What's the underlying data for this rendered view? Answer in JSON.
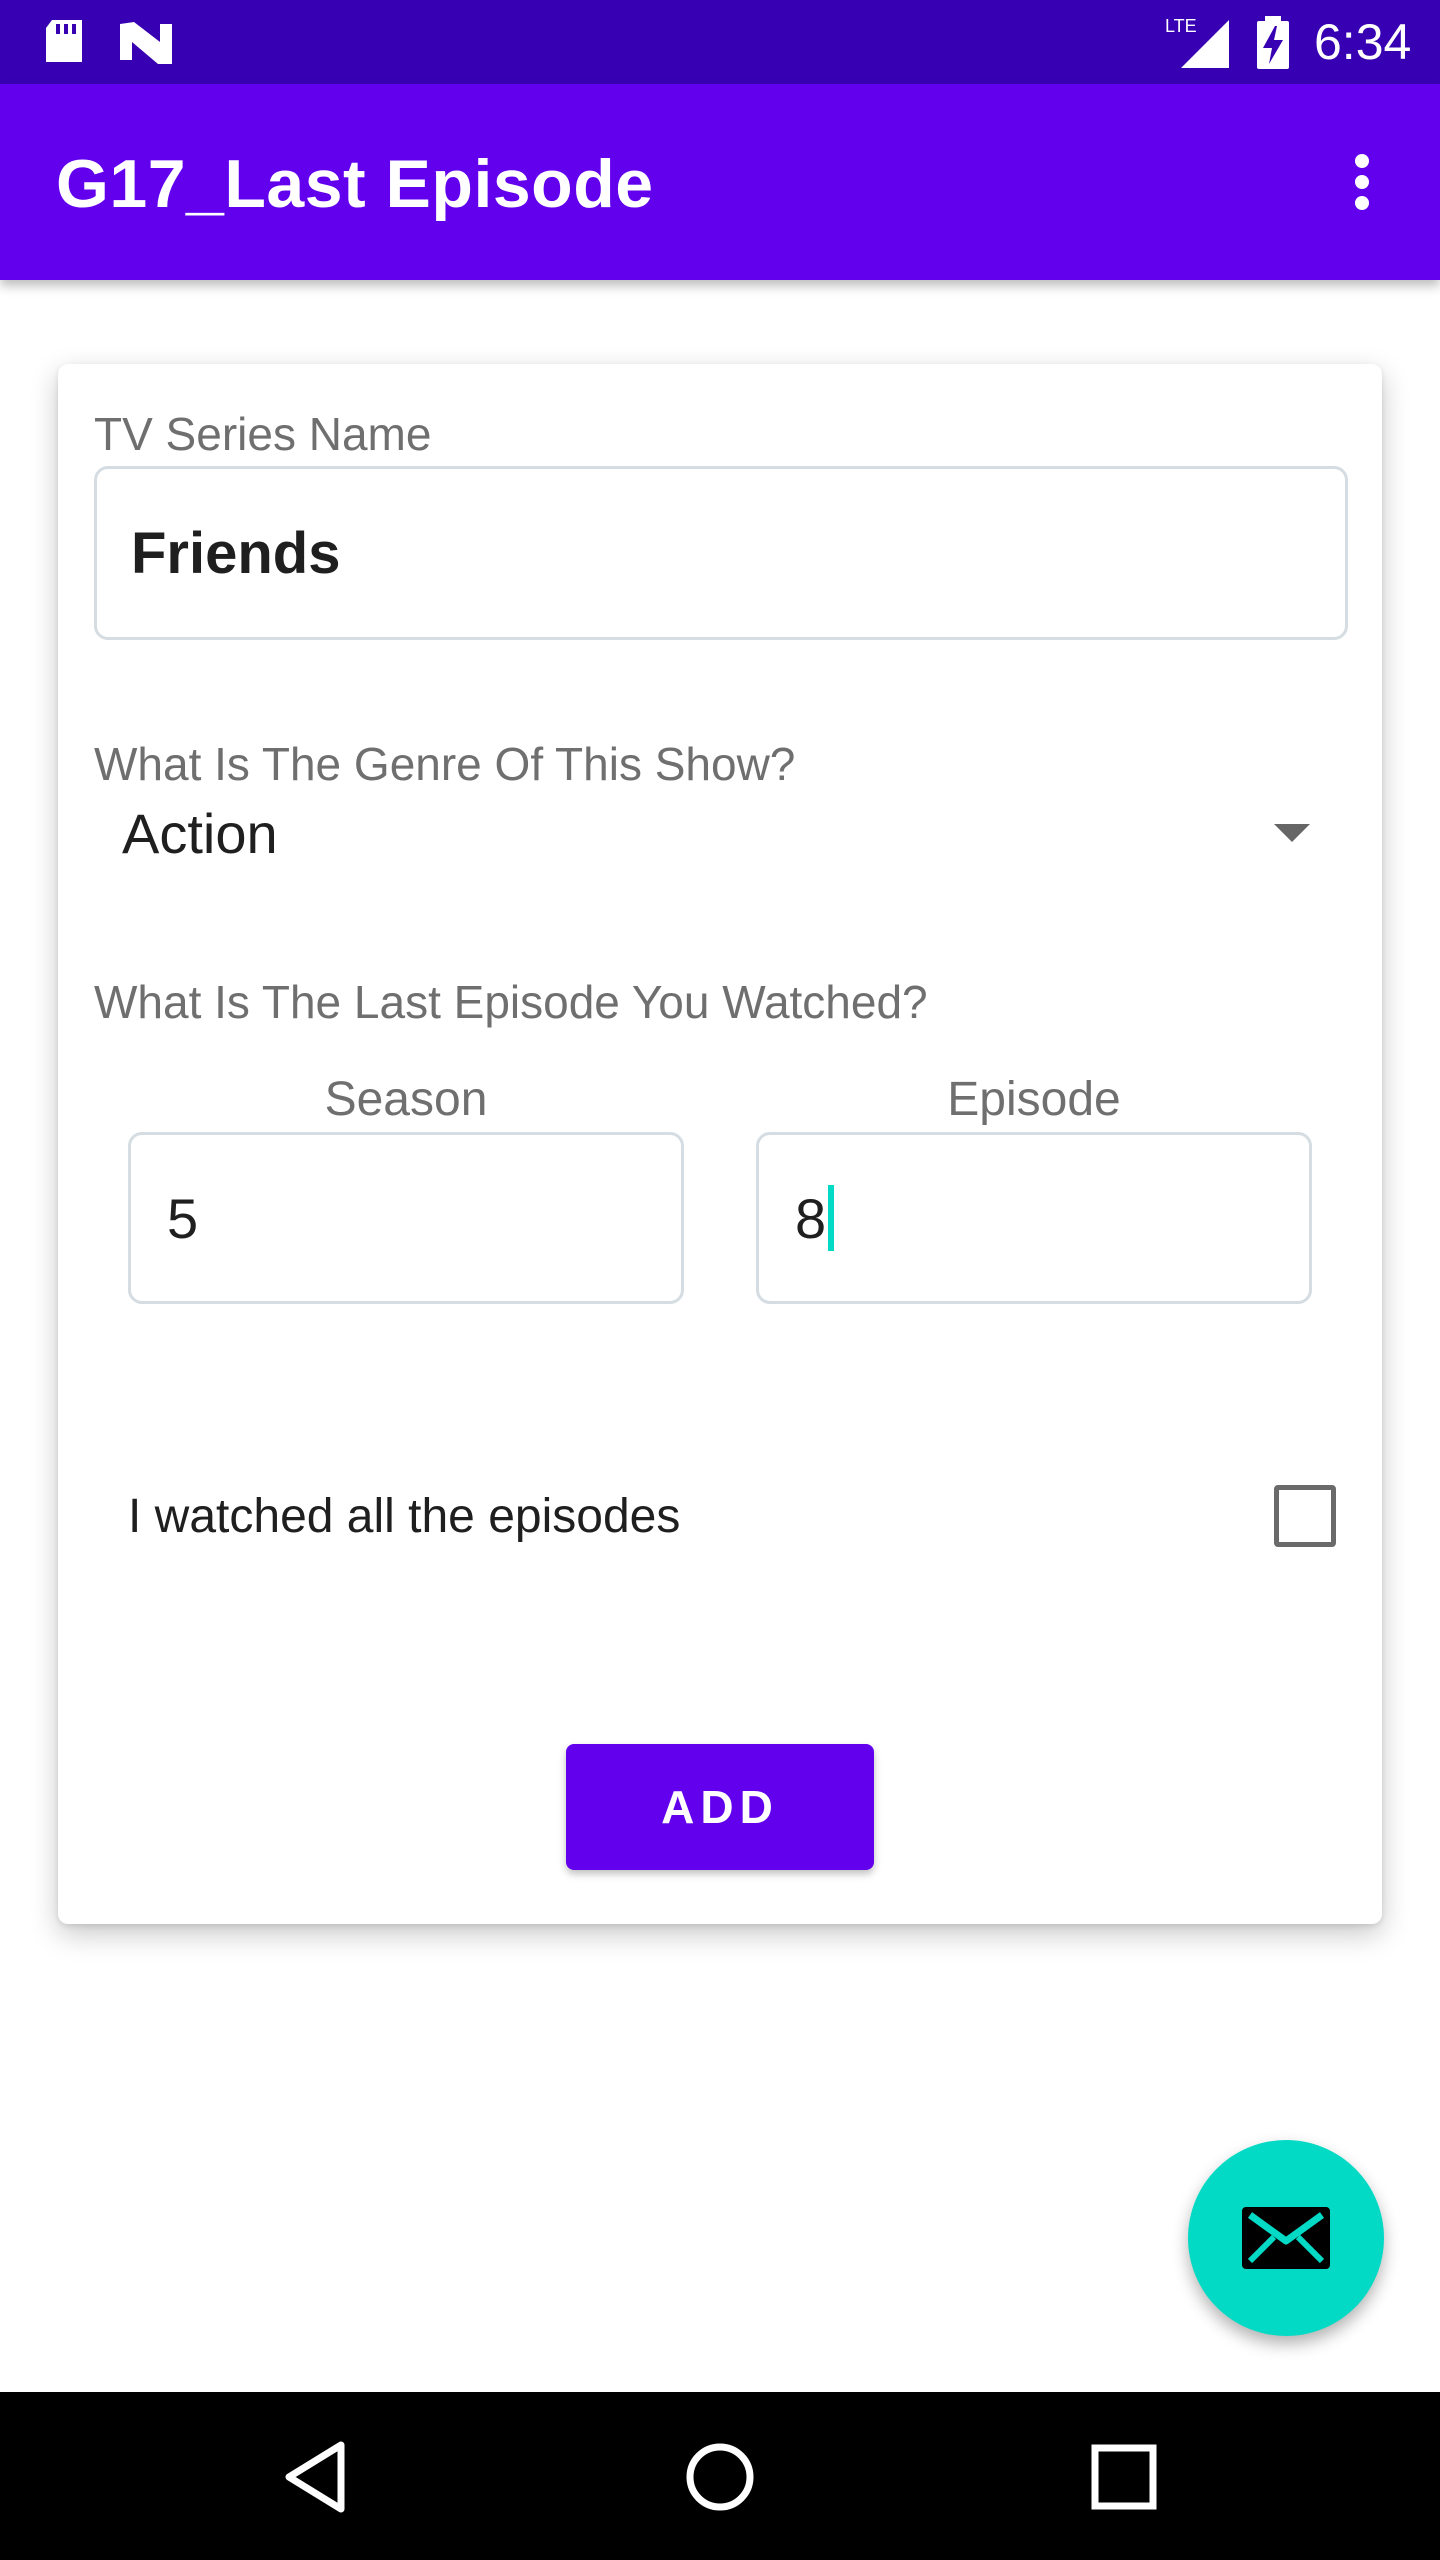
{
  "status_bar": {
    "time": "6:34",
    "icons": [
      "sd-card-icon",
      "n-icon",
      "lte-signal-icon",
      "battery-charging-icon"
    ],
    "lte_label": "LTE",
    "background": "#3700b3"
  },
  "app_bar": {
    "title": "G17_Last Episode",
    "menu_icon": "more-vert-icon",
    "background": "#6200ee"
  },
  "form": {
    "series_label": "TV Series Name",
    "series_value": "Friends",
    "genre_label": "What Is The Genre Of This Show?",
    "genre_value": "Action",
    "last_episode_label": "What Is The Last Episode You Watched?",
    "season_label": "Season",
    "season_value": "5",
    "episode_label": "Episode",
    "episode_value": "8",
    "watched_all_label": "I watched all the episodes",
    "watched_all_checked": false,
    "add_button": "ADD"
  },
  "fab": {
    "icon": "email-icon",
    "color": "#03dac5"
  },
  "nav_bar": {
    "buttons": [
      "back-icon",
      "home-icon",
      "recents-icon"
    ]
  }
}
